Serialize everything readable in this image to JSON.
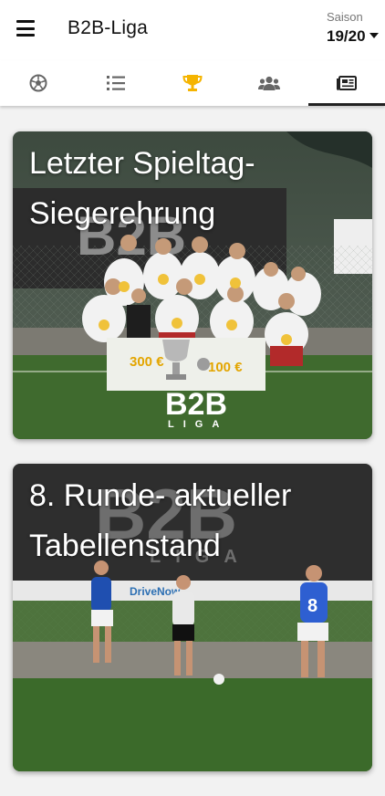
{
  "header": {
    "title": "B2B-Liga",
    "season_label": "Saison",
    "season_value": "19/20"
  },
  "tabs": [
    {
      "icon": "soccer-ball-icon",
      "active": false
    },
    {
      "icon": "ranked-list-icon",
      "active": false
    },
    {
      "icon": "trophy-icon",
      "active": false,
      "color": "#f5b400"
    },
    {
      "icon": "users-icon",
      "active": false
    },
    {
      "icon": "newspaper-icon",
      "active": true
    }
  ],
  "news": [
    {
      "title": "Letzter Spieltag-Siegerehrung",
      "banner_text": "B2B",
      "prize_left": "300 €",
      "prize_right": "100 €",
      "logo_main": "B2B",
      "logo_sub": "LIGA"
    },
    {
      "title": "8. Runde- aktueller Tabellenstand",
      "banner_text": "B2B",
      "banner_sub": "LIGA",
      "sponsor": "DriveNow",
      "jersey_number": "8"
    }
  ],
  "colors": {
    "accent": "#f5b400",
    "text": "#111111",
    "muted": "#777777"
  }
}
